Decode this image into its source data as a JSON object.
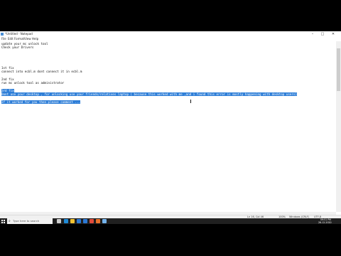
{
  "window": {
    "title": "*Untitled - Notepad",
    "minimize": "–",
    "maximize": "□",
    "close": "✕"
  },
  "menu": [
    "File",
    "Edit",
    "Format",
    "View",
    "Help"
  ],
  "editor": {
    "lines": [
      "update your mc unlock tool",
      "Check your Drivers",
      "1st fix",
      "connect into ecbl.m dont connect it in ecbl.m",
      "2nd fix",
      "run mc unlock tool as administrator",
      "3rd fix",
      "Dont use your desktop , for unlocking use your friends/relatives laptop ( because this worked with me ,and i found this error is mostly happening with desktop users)",
      "If it worked for you then please comment ..."
    ]
  },
  "status": {
    "position": "Ln 16, Col 46",
    "zoom": "100%",
    "line_ending": "Windows (CRLF)",
    "encoding": "UTF-8"
  },
  "taskbar": {
    "search_placeholder": "Type here to search",
    "time": "09:51 PM",
    "date": "26-12-2020",
    "icons": [
      "task-view-icon",
      "edge-icon",
      "file-explorer-icon",
      "store-icon",
      "mail-icon",
      "chrome-icon",
      "firefox-icon",
      "notepad-icon"
    ],
    "icon_colors": [
      "#cccccc",
      "#1f8ad6",
      "#f1c232",
      "#2b78d4",
      "#2b78d4",
      "#e24b3b",
      "#e8712a",
      "#74b3ec"
    ]
  }
}
